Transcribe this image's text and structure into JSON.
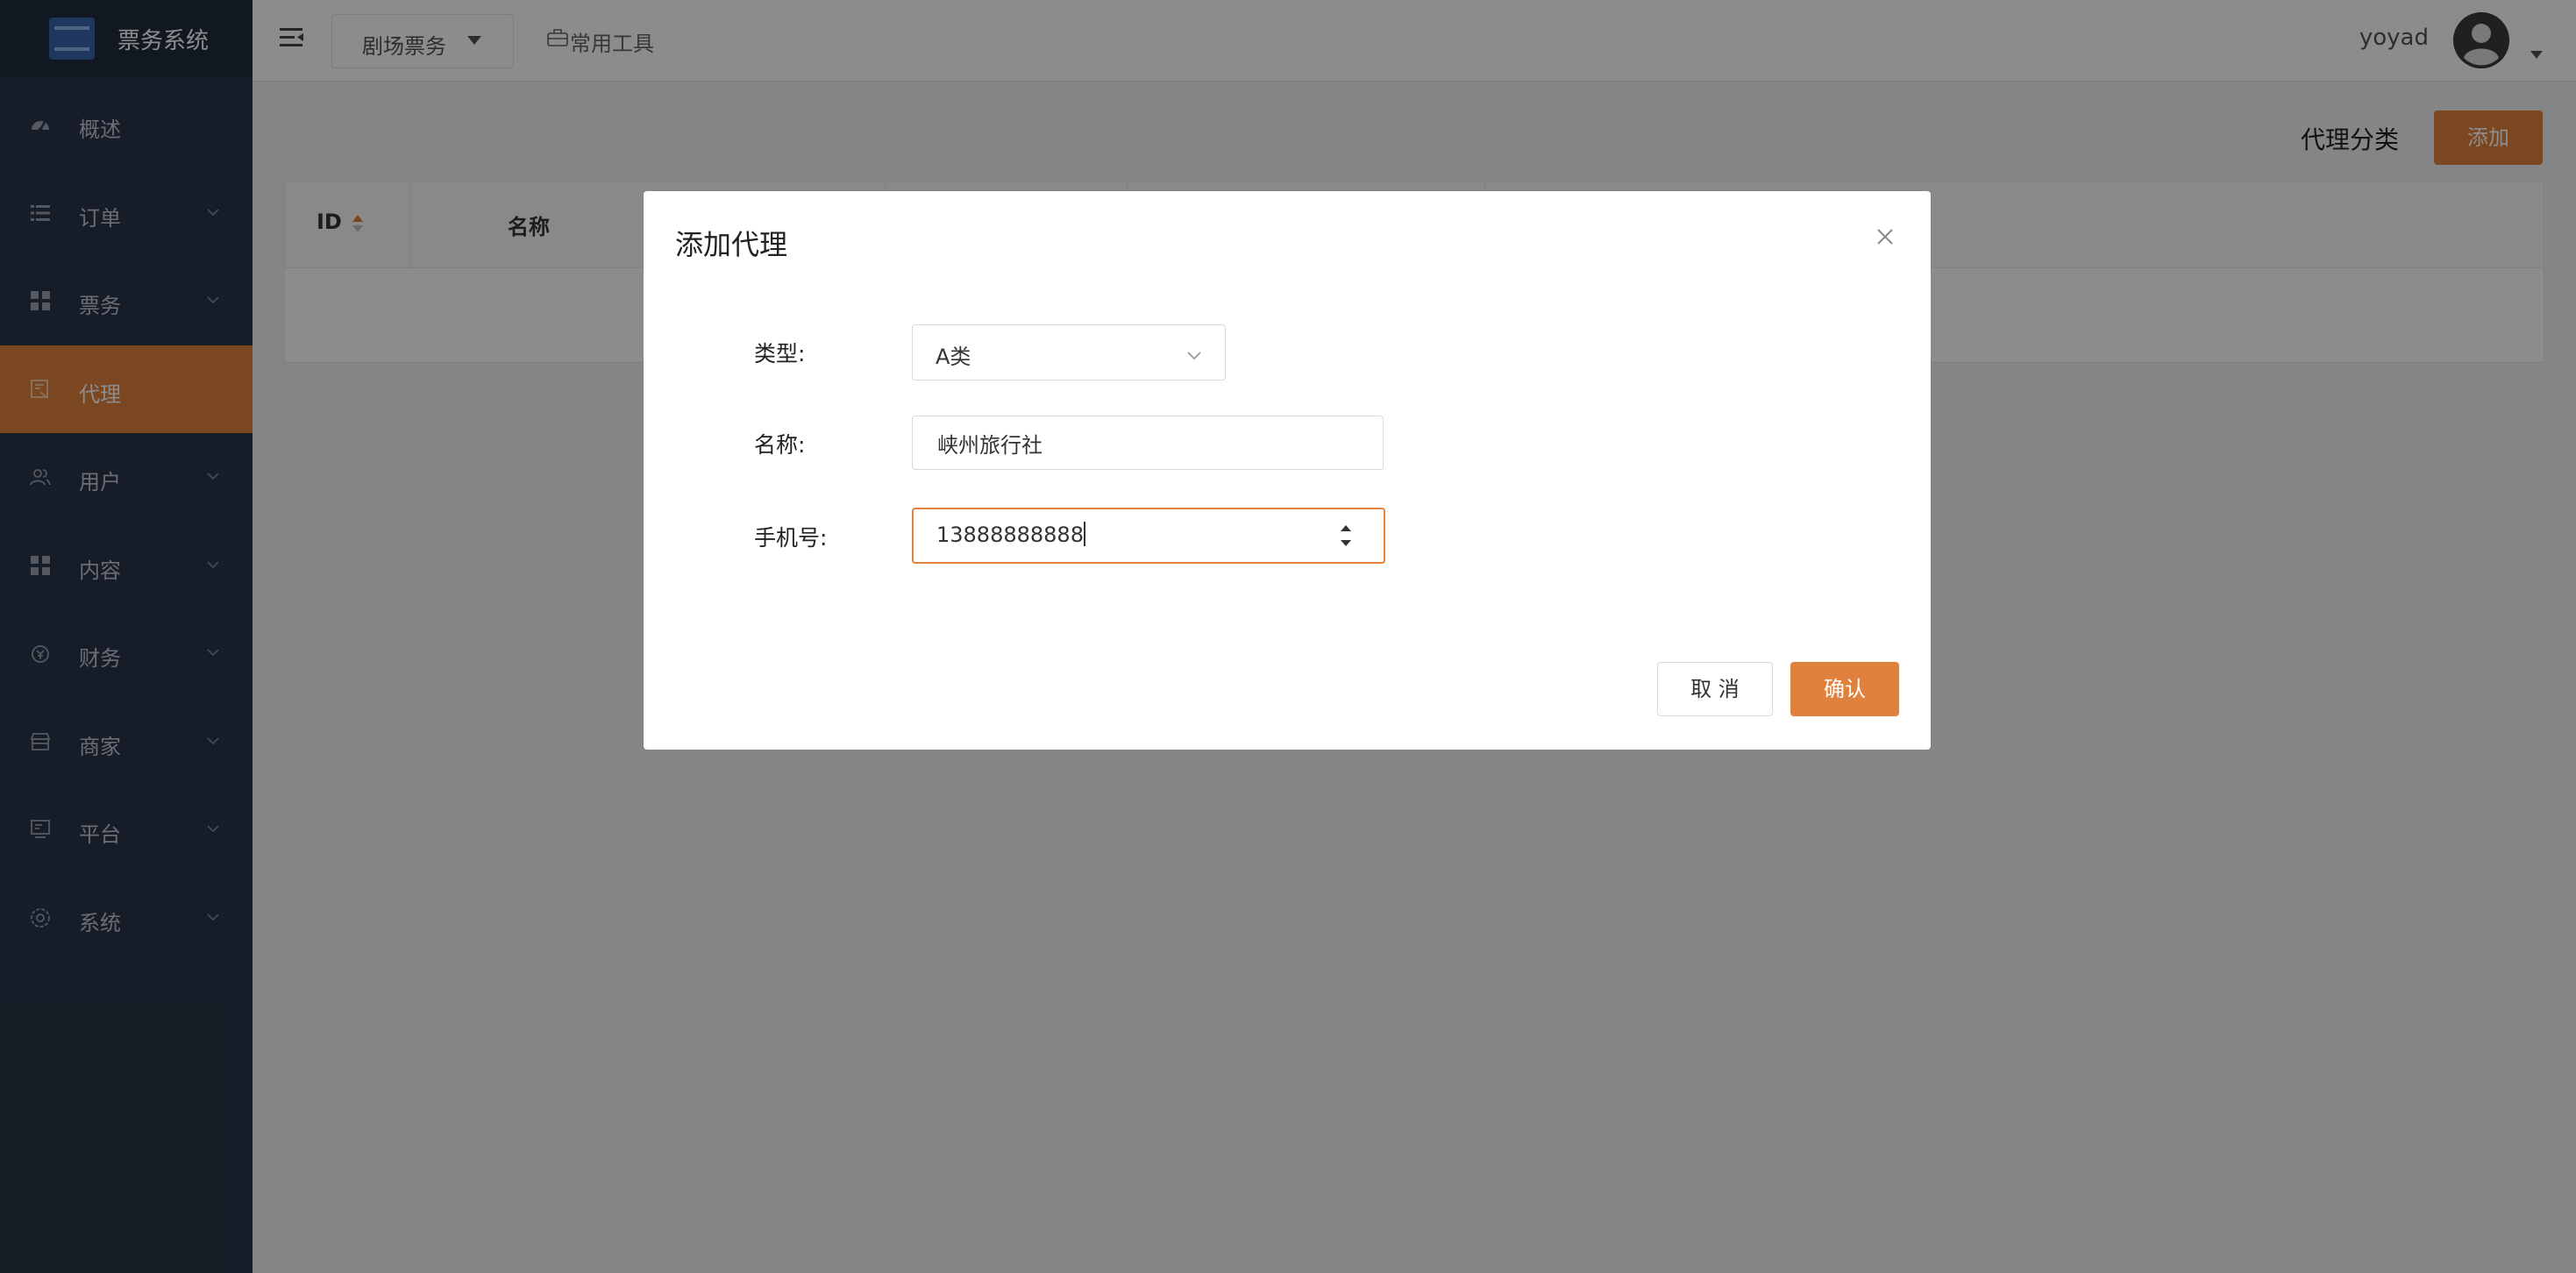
{
  "app": {
    "title": "票务系统"
  },
  "sidebar": {
    "items": [
      {
        "label": "概述",
        "icon": "dashboard-icon",
        "has_children": false,
        "active": false
      },
      {
        "label": "订单",
        "icon": "list-icon",
        "has_children": true,
        "active": false
      },
      {
        "label": "票务",
        "icon": "grid-icon",
        "has_children": true,
        "active": false
      },
      {
        "label": "代理",
        "icon": "agent-icon",
        "has_children": false,
        "active": true
      },
      {
        "label": "用户",
        "icon": "users-icon",
        "has_children": true,
        "active": false
      },
      {
        "label": "内容",
        "icon": "grid-icon",
        "has_children": true,
        "active": false
      },
      {
        "label": "财务",
        "icon": "finance-icon",
        "has_children": true,
        "active": false
      },
      {
        "label": "商家",
        "icon": "shop-icon",
        "has_children": true,
        "active": false
      },
      {
        "label": "平台",
        "icon": "monitor-icon",
        "has_children": true,
        "active": false
      },
      {
        "label": "系统",
        "icon": "settings-icon",
        "has_children": true,
        "active": false
      }
    ]
  },
  "header": {
    "nav_dropdown_label": "剧场票务",
    "tools_label": "常用工具",
    "username": "yoyad"
  },
  "content": {
    "section_title": "代理分类",
    "add_label": "添加",
    "table": {
      "columns": [
        "ID",
        "名称"
      ]
    }
  },
  "modal": {
    "title": "添加代理",
    "type_label": "类型:",
    "type_value": "A类",
    "name_label": "名称:",
    "name_value": "峡州旅行社",
    "phone_label": "手机号:",
    "phone_value": "13888888888",
    "cancel_label": "取 消",
    "ok_label": "确认"
  },
  "colors": {
    "accent": "#e0823d",
    "sidebar_bg": "#2b3649",
    "sidebar_logo_bg": "#222c3c"
  }
}
